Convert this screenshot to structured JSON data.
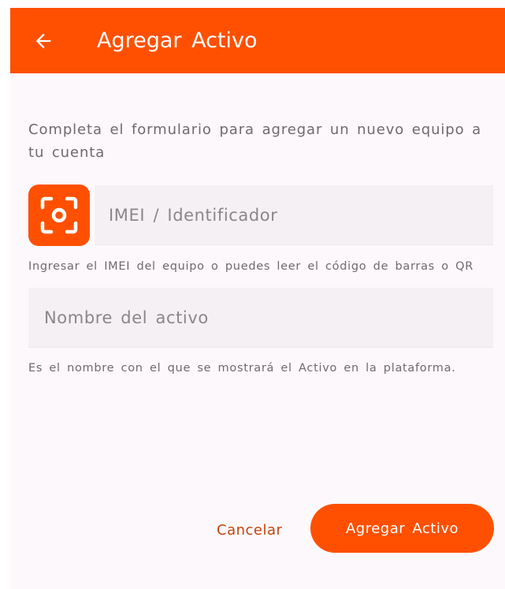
{
  "appbar": {
    "title": "Agregar Activo",
    "back_icon": "arrow-left-icon",
    "color": "#fe5000"
  },
  "form": {
    "intro": "Completa el formulario para agregar un nuevo equipo a tu cuenta",
    "scan_icon": "scan-qr-icon",
    "imei": {
      "placeholder": "IMEI / Identificador",
      "value": "",
      "helper": "Ingresar el IMEI del equipo o puedes leer el código de barras o QR"
    },
    "name": {
      "placeholder": "Nombre del activo",
      "value": "",
      "helper": "Es el nombre con el que se mostrará el Activo en la plataforma."
    }
  },
  "actions": {
    "cancel_label": "Cancelar",
    "submit_label": "Agregar Activo"
  },
  "colors": {
    "accent": "#fe5000",
    "background": "#fdf8fc",
    "field_background": "#f4f0f3",
    "muted_text": "#6f6a6e"
  }
}
